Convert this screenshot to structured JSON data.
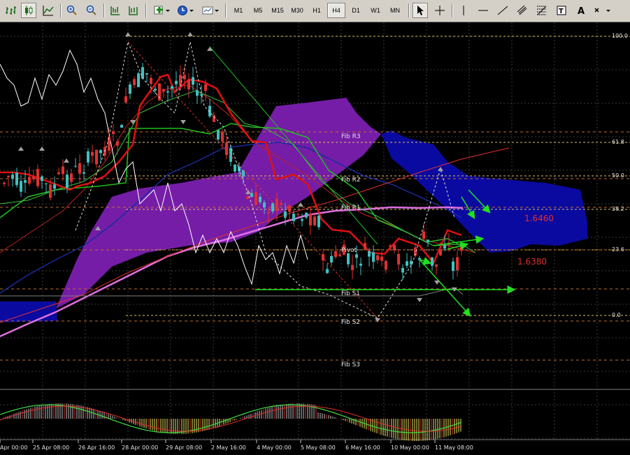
{
  "toolbar": {
    "timeframes": [
      "M1",
      "M5",
      "M15",
      "M30",
      "H1",
      "H4",
      "D1",
      "W1",
      "MN"
    ],
    "active_timeframe": "H4",
    "icons": [
      "bar-chart-icon",
      "candlestick-icon",
      "line-chart-icon",
      "zoom-in-icon",
      "zoom-out-icon",
      "autoscroll-icon",
      "chart-shift-icon",
      "indicators-icon",
      "periods-clock-icon",
      "templates-icon",
      "cursor-icon",
      "crosshair-icon",
      "vertical-line-icon",
      "horizontal-line-icon",
      "trendline-icon",
      "equidistant-channel-icon",
      "fibonacci-icon",
      "text-icon",
      "text-label-icon",
      "arrows-icon"
    ]
  },
  "colors": {
    "background": "#000000",
    "grid": "#3a3a3a",
    "fib_levels": "#e0c060",
    "pivot_lines": "#c07030",
    "price_label": "#e03030",
    "kumo_bear": "#7b1fb0",
    "kumo_bull": "#0a0aa0",
    "tenkan": "#e01010",
    "kijun": "#20c020",
    "chikou": "#ffffff",
    "ma_pink": "#e070e0",
    "ma_navy": "#1a2aa0",
    "bull_candle": "#40c0c0",
    "bear_candle": "#e03030",
    "arrow_green": "#20e020"
  },
  "chart_data": {
    "type": "candlestick",
    "fib_retracement_labels": [
      "100.0",
      "61.8",
      "50.0",
      "38.2",
      "23.6",
      "0.0"
    ],
    "pivot_labels": [
      "Fib R3",
      "Fib R2",
      "Fib R1",
      "Pivot",
      "Fib S1",
      "Fib S2",
      "Fib S3"
    ],
    "price_annotations": [
      "1.6460",
      "1.6380"
    ],
    "x_ticks": [
      "Apr 00:00",
      "25 Apr 08:00",
      "26 Apr 16:00",
      "28 Apr 00:00",
      "29 Apr 08:00",
      "2 May 16:00",
      "4 May 00:00",
      "5 May 08:00",
      "6 May 16:00",
      "10 May 00:00",
      "11 May 08:00"
    ]
  }
}
